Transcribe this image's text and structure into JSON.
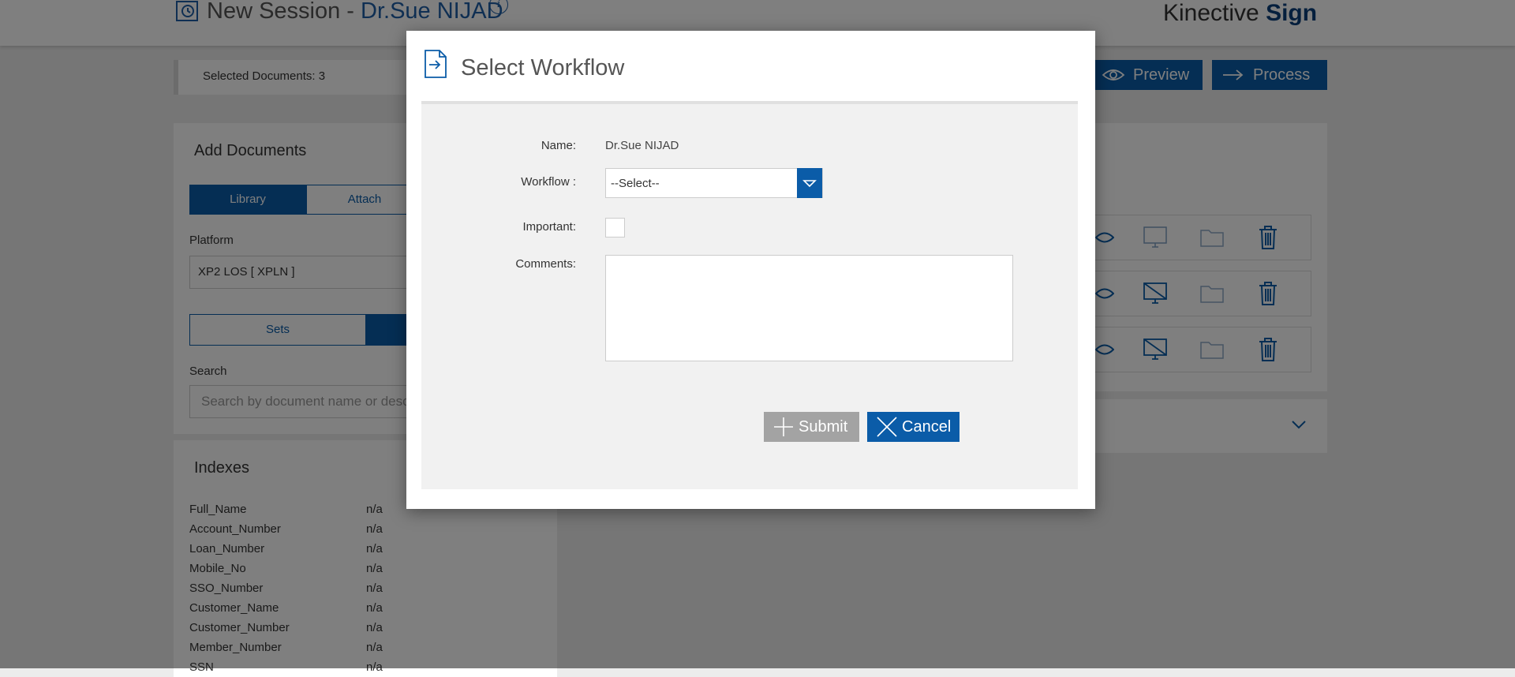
{
  "header": {
    "title_prefix": "New Session - ",
    "patient_name": "Dr.Sue NIJAD",
    "info_symbol": "i",
    "brand_light": "Kinective ",
    "brand_bold": "Sign"
  },
  "toolbar": {
    "selected_documents": "Selected Documents: 3",
    "preview_label": "Preview",
    "process_label": "Process"
  },
  "add_documents": {
    "title": "Add Documents",
    "tabs": [
      "Library",
      "Attach"
    ],
    "platform_label": "Platform",
    "platform_value": "XP2 LOS [ XPLN ]",
    "sets_label": "Sets",
    "search_label": "Search",
    "search_placeholder": "Search by document name or description"
  },
  "indexes": {
    "title": "Indexes",
    "rows": [
      {
        "name": "Full_Name",
        "value": "n/a"
      },
      {
        "name": "Account_Number",
        "value": "n/a"
      },
      {
        "name": "Loan_Number",
        "value": "n/a"
      },
      {
        "name": "Mobile_No",
        "value": "n/a"
      },
      {
        "name": "SSO_Number",
        "value": "n/a"
      },
      {
        "name": "Customer_Name",
        "value": "n/a"
      },
      {
        "name": "Customer_Number",
        "value": "n/a"
      },
      {
        "name": "Member_Number",
        "value": "n/a"
      },
      {
        "name": "SSN",
        "value": "n/a"
      }
    ]
  },
  "modal": {
    "title": "Select Workflow",
    "name_label": "Name:",
    "name_value": "Dr.Sue NIJAD",
    "workflow_label": "Workflow :",
    "workflow_selected": "--Select--",
    "important_label": "Important:",
    "comments_label": "Comments:",
    "comments_value": "",
    "submit_label": "Submit",
    "cancel_label": "Cancel"
  },
  "colors": {
    "accent": "#0b5ca8",
    "brand_dark": "#0b3f7a",
    "submit_disabled": "#a3a3a3"
  }
}
